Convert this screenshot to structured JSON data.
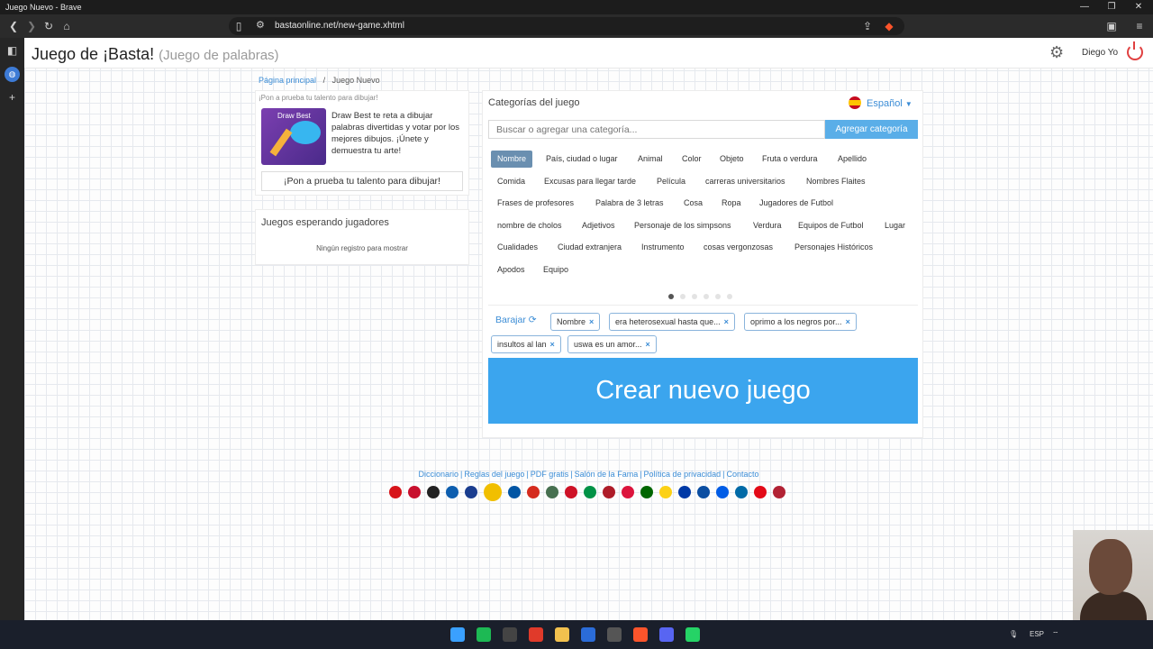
{
  "window": {
    "title": "Juego Nuevo - Brave",
    "controls": [
      "—",
      "❐",
      "✕"
    ]
  },
  "browser": {
    "url": "bastaonline.net/new-game.xhtml",
    "icons": [
      "back-icon",
      "forward-icon",
      "reload-icon",
      "home-icon",
      "bookmark-icon",
      "share-icon",
      "brave-shield-icon",
      "wallet-icon",
      "menu-icon"
    ]
  },
  "header": {
    "title": "Juego de ¡Basta!",
    "subtitle": "(Juego de palabras)",
    "user": "Diego Yo"
  },
  "breadcrumb": {
    "home": "Página principal",
    "separator": "/",
    "current": "Juego Nuevo"
  },
  "promo": {
    "top_text": "¡Pon a prueba tu talento para dibujar!",
    "image_label": "Draw Best",
    "text": "Draw Best te reta a dibujar palabras divertidas y votar por los mejores dibujos. ¡Únete y demuestra tu arte!",
    "button": "¡Pon a prueba tu talento para dibujar!"
  },
  "waiting": {
    "title": "Juegos esperando jugadores",
    "empty": "Ningún registro para mostrar"
  },
  "categories": {
    "title": "Categorías del juego",
    "language": "Español",
    "search_placeholder": "Buscar o agregar una categoría...",
    "add_button": "Agregar categoría",
    "items": [
      "Nombre",
      "País, ciudad o lugar",
      "Animal",
      "Color",
      "Objeto",
      "Fruta o verdura",
      "Apellido",
      "Comida",
      "Excusas para llegar tarde",
      "Película",
      "carreras universitarios",
      "Nombres Flaites",
      "Frases de profesores",
      "Palabra de 3 letras",
      "Cosa",
      "Ropa",
      "Jugadores de Futbol",
      "nombre de cholos",
      "Adjetivos",
      "Personaje de los simpsons",
      "Verdura",
      "Equipos de Futbol",
      "Lugar",
      "Cualidades",
      "Ciudad extranjera",
      "Instrumento",
      "cosas vergonzosas",
      "Personajes Históricos",
      "Apodos",
      "Equipo"
    ],
    "active_index": 0,
    "pages": 6,
    "current_page": 1
  },
  "selected": {
    "shuffle_label": "Barajar",
    "tags": [
      "Nombre",
      "era heterosexual hasta que...",
      "oprimo a los negros por...",
      "insultos al lan",
      "uswa es un amor..."
    ]
  },
  "create_button": "Crear nuevo juego",
  "footer": {
    "links": [
      "Diccionario",
      "Reglas del juego",
      "PDF gratis",
      "Salón de la Fama",
      "Política de privacidad",
      "Contacto"
    ],
    "separator": "|",
    "flags": [
      {
        "name": "czech-flag",
        "color": "#d7141a"
      },
      {
        "name": "denmark-flag",
        "color": "#c8102e"
      },
      {
        "name": "germany-flag",
        "color": "#222222"
      },
      {
        "name": "greece-flag",
        "color": "#0d5eaf"
      },
      {
        "name": "uk-flag",
        "color": "#1a3d8f"
      },
      {
        "name": "spain-flag",
        "color": "#f1bf00"
      },
      {
        "name": "france-flag",
        "color": "#0055a4"
      },
      {
        "name": "croatia-flag",
        "color": "#d52b1e"
      },
      {
        "name": "hungary-flag",
        "color": "#477050"
      },
      {
        "name": "indonesia-flag",
        "color": "#ce1126"
      },
      {
        "name": "italy-flag",
        "color": "#009246"
      },
      {
        "name": "netherlands-flag",
        "color": "#ae1c28"
      },
      {
        "name": "poland-flag",
        "color": "#dc143c"
      },
      {
        "name": "portugal-flag",
        "color": "#006600"
      },
      {
        "name": "romania-flag",
        "color": "#fcd116"
      },
      {
        "name": "russia-flag",
        "color": "#0039a6"
      },
      {
        "name": "slovakia-flag",
        "color": "#0b4ea2"
      },
      {
        "name": "slovenia-flag",
        "color": "#005ce6"
      },
      {
        "name": "sweden-flag",
        "color": "#006aa7"
      },
      {
        "name": "turkey-flag",
        "color": "#e30a17"
      },
      {
        "name": "usa-flag",
        "color": "#b22234"
      }
    ]
  },
  "taskbar": {
    "tray_lang": "ESP",
    "apps": [
      {
        "name": "windows-start-icon",
        "color": "#3aa0ff"
      },
      {
        "name": "spotify-icon",
        "color": "#1db954"
      },
      {
        "name": "obs-icon",
        "color": "#444444"
      },
      {
        "name": "acrobat-icon",
        "color": "#e03a2a"
      },
      {
        "name": "files-icon",
        "color": "#f2c14e"
      },
      {
        "name": "word-icon",
        "color": "#2b6cd8"
      },
      {
        "name": "davinci-icon",
        "color": "#555555"
      },
      {
        "name": "brave-icon",
        "color": "#fb542b"
      },
      {
        "name": "discord-icon",
        "color": "#5865f2"
      },
      {
        "name": "whatsapp-icon",
        "color": "#25d366"
      }
    ]
  }
}
